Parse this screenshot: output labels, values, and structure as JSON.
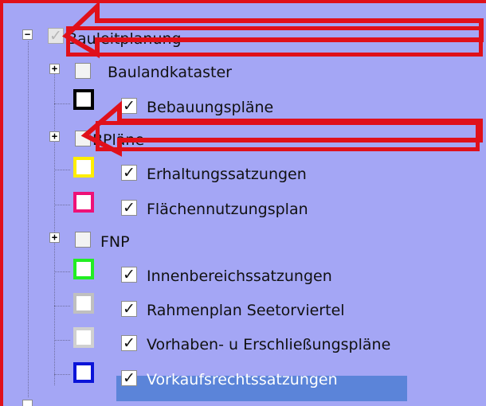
{
  "tree": {
    "root": {
      "label": "Bauleitplanung",
      "expanded": true,
      "checkbox": "indeterminate"
    },
    "items": [
      {
        "label": "Baulandkataster",
        "type": "group",
        "checked": false
      },
      {
        "label": "Bebauungspläne",
        "type": "layer",
        "checked": true,
        "swatch_color": "#000000"
      },
      {
        "label": "BPläne",
        "type": "group",
        "checked": false
      },
      {
        "label": "Erhaltungssatzungen",
        "type": "layer",
        "checked": true,
        "swatch_color": "#ffee00"
      },
      {
        "label": "Flächennutzungsplan",
        "type": "layer",
        "checked": true,
        "swatch_color": "#ee1177"
      },
      {
        "label": "FNP",
        "type": "group",
        "checked": false
      },
      {
        "label": "Innenbereichssatzungen",
        "type": "layer",
        "checked": true,
        "swatch_color": "#22ee22"
      },
      {
        "label": "Rahmenplan Seetorviertel",
        "type": "layer",
        "checked": true,
        "swatch_color": "#c0c0c0"
      },
      {
        "label": "Vorhaben- u Erschließungspläne",
        "type": "layer",
        "checked": true,
        "swatch_color": "#d0d0d0"
      },
      {
        "label": "Vorkaufsrechtssatzungen",
        "type": "layer",
        "checked": true,
        "swatch_color": "#0a14d8",
        "selected": true
      }
    ]
  },
  "glyphs": {
    "expanded": "−",
    "collapsed": "+",
    "check": "✓"
  },
  "colors": {
    "background": "#a4a6f5",
    "selection": "#5b84d9",
    "annotation": "#e0101a"
  }
}
